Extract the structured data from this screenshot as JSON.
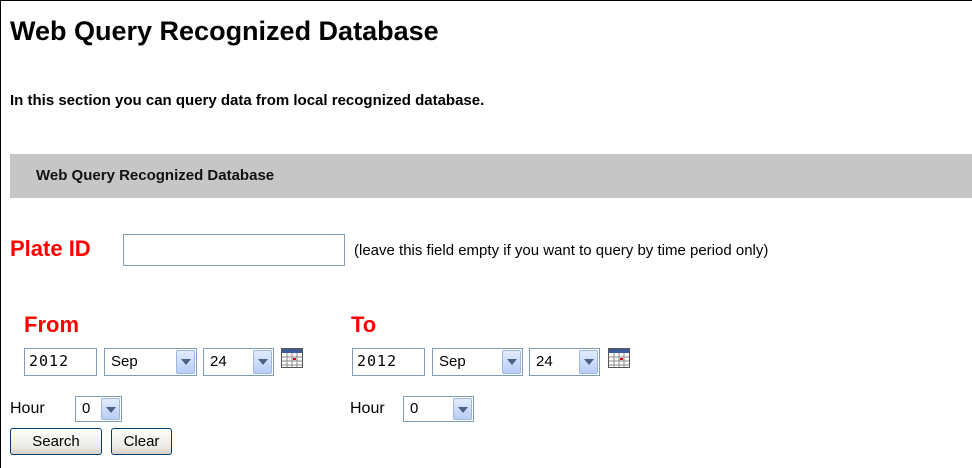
{
  "page": {
    "title": "Web Query Recognized Database",
    "intro": "In this section you can query data from local recognized database.",
    "section_title": "Web Query Recognized Database"
  },
  "plate": {
    "label": "Plate ID",
    "value": "",
    "hint": "(leave this field empty if you want to query by time period only)"
  },
  "from": {
    "label": "From",
    "year": "2012",
    "month": "Sep",
    "day": "24",
    "hour_label": "Hour",
    "hour": "0"
  },
  "to": {
    "label": "To",
    "year": "2012",
    "month": "Sep",
    "day": "24",
    "hour_label": "Hour",
    "hour": "0"
  },
  "buttons": {
    "search": "Search",
    "clear": "Clear"
  },
  "icons": {
    "calendar": "calendar-icon",
    "dropdown": "chevron-down-icon"
  }
}
